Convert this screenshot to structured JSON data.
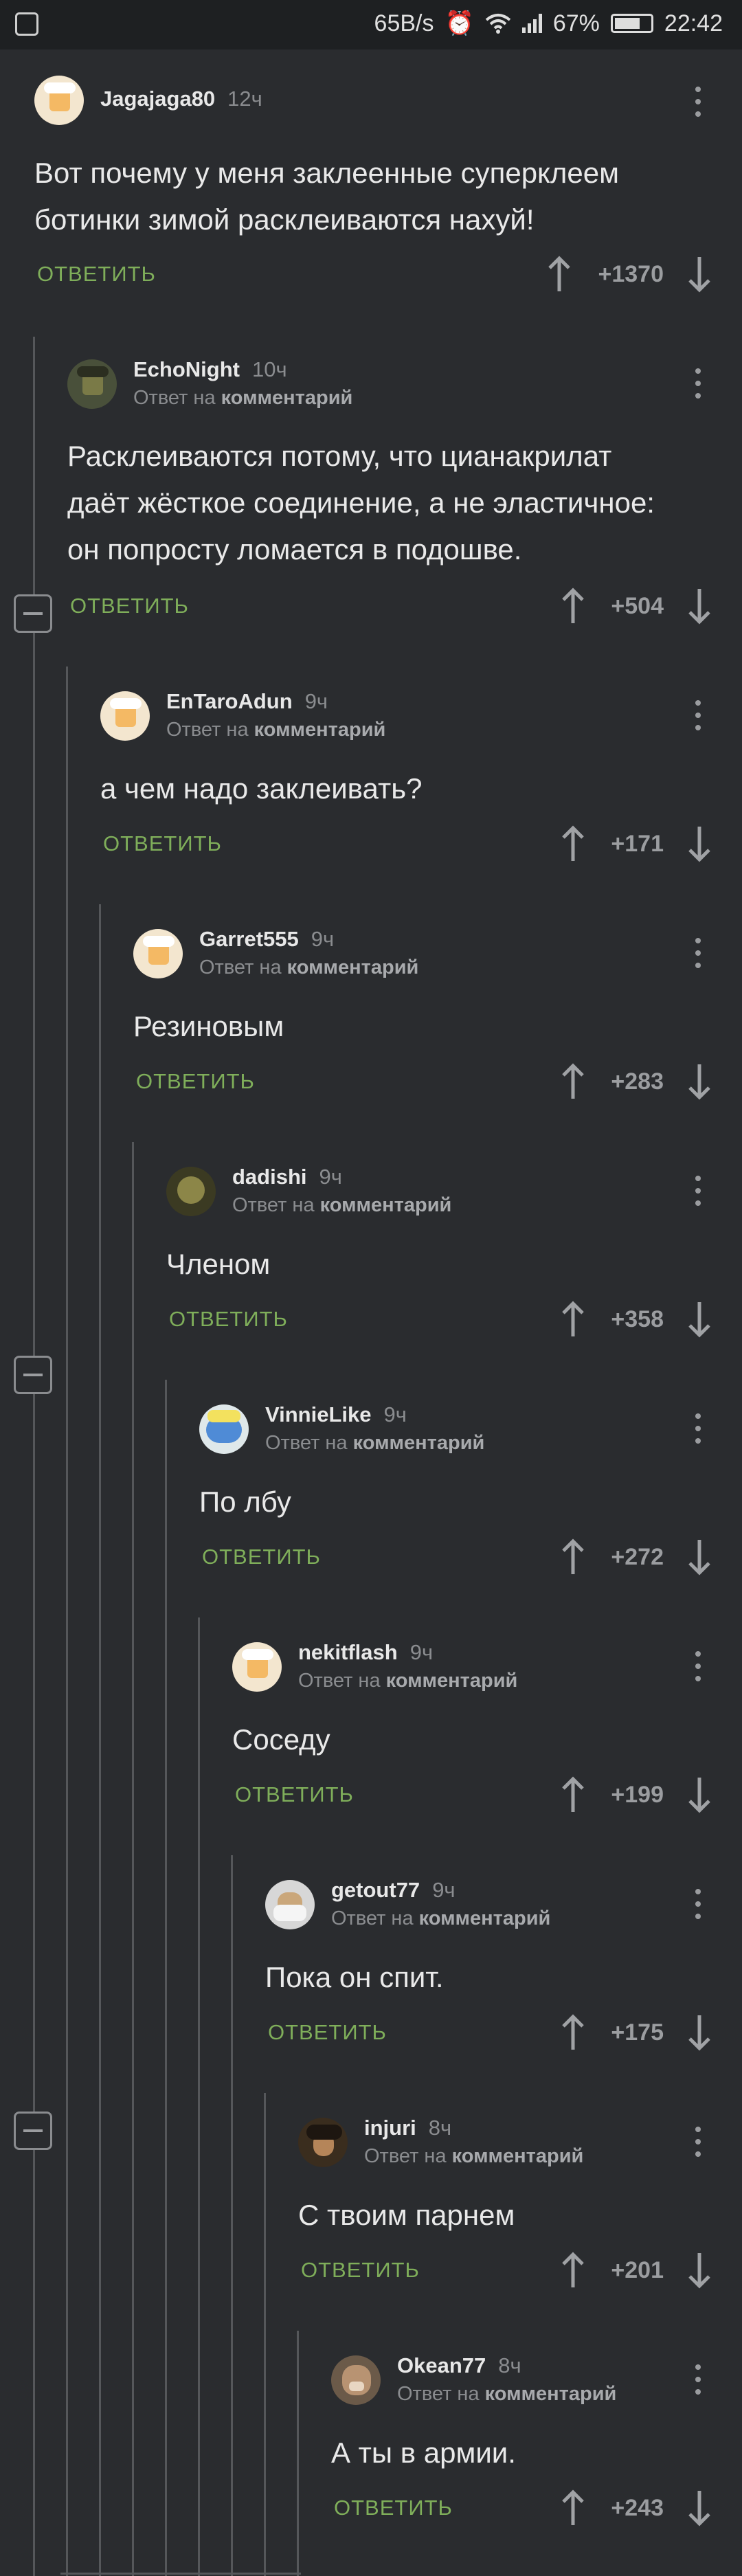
{
  "status_bar": {
    "speed": "65B/s",
    "battery": "67%",
    "time": "22:42"
  },
  "comments": [
    {
      "user": "Jagajaga80",
      "time": "12ч",
      "reply_label": "",
      "reply_target": "",
      "lines": [
        "Вот почему у меня заклеенные суперклеем",
        "ботинки зимой расклеиваются нахуй!"
      ],
      "answer": "ОТВЕТИТЬ",
      "rating": "+1370"
    },
    {
      "user": "EchoNight",
      "time": "10ч",
      "reply_label": "Ответ на",
      "reply_target": "комментарий",
      "lines": [
        "Расклеиваются потому, что цианакрилат",
        "даёт жёсткое соединение, а не эластичное:",
        "он попросту ломается в подошве."
      ],
      "answer": "ОТВЕТИТЬ",
      "rating": "+504"
    },
    {
      "user": "EnTaroAdun",
      "time": "9ч",
      "reply_label": "Ответ на",
      "reply_target": "комментарий",
      "lines": [
        "а чем надо заклеивать?"
      ],
      "answer": "ОТВЕТИТЬ",
      "rating": "+171"
    },
    {
      "user": "Garret555",
      "time": "9ч",
      "reply_label": "Ответ на",
      "reply_target": "комментарий",
      "lines": [
        "Резиновым"
      ],
      "answer": "ОТВЕТИТЬ",
      "rating": "+283"
    },
    {
      "user": "dadishi",
      "time": "9ч",
      "reply_label": "Ответ на",
      "reply_target": "комментарий",
      "lines": [
        "Членом"
      ],
      "answer": "ОТВЕТИТЬ",
      "rating": "+358"
    },
    {
      "user": "VinnieLike",
      "time": "9ч",
      "reply_label": "Ответ на",
      "reply_target": "комментарий",
      "lines": [
        "По лбу"
      ],
      "answer": "ОТВЕТИТЬ",
      "rating": "+272"
    },
    {
      "user": "nekitflash",
      "time": "9ч",
      "reply_label": "Ответ на",
      "reply_target": "комментарий",
      "lines": [
        "Соседу"
      ],
      "answer": "ОТВЕТИТЬ",
      "rating": "+199"
    },
    {
      "user": "getout77",
      "time": "9ч",
      "reply_label": "Ответ на",
      "reply_target": "комментарий",
      "lines": [
        "Пока он спит."
      ],
      "answer": "ОТВЕТИТЬ",
      "rating": "+175"
    },
    {
      "user": "injuri",
      "time": "8ч",
      "reply_label": "Ответ на",
      "reply_target": "комментарий",
      "lines": [
        "С твоим парнем"
      ],
      "answer": "ОТВЕТИТЬ",
      "rating": "+201"
    },
    {
      "user": "Okean77",
      "time": "8ч",
      "reply_label": "Ответ на",
      "reply_target": "комментарий",
      "lines": [
        "А ты в армии."
      ],
      "answer": "ОТВЕТИТЬ",
      "rating": "+243"
    }
  ]
}
